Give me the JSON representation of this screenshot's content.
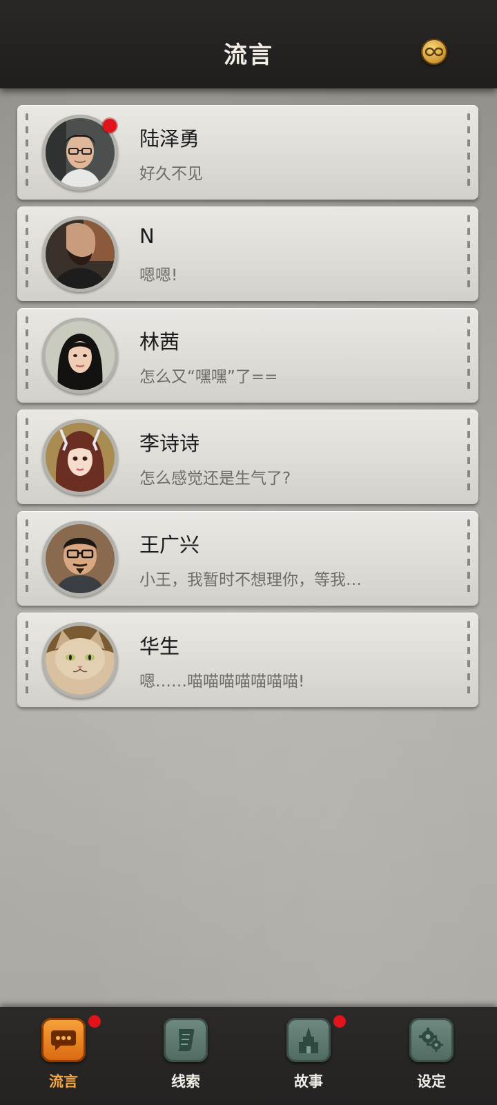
{
  "header": {
    "title": "流言",
    "right_icon": "infinity-coin-icon"
  },
  "messages": [
    {
      "name": "陆泽勇",
      "preview": "好久不见",
      "unread": true,
      "avatar": "man-with-glasses-avatar"
    },
    {
      "name": "N",
      "preview": "嗯嗯!",
      "unread": false,
      "avatar": "bearded-man-avatar"
    },
    {
      "name": "林茜",
      "preview": "怎么又“嘿嘿”了==",
      "unread": false,
      "avatar": "woman-long-hair-avatar"
    },
    {
      "name": "李诗诗",
      "preview": "怎么感觉还是生气了?",
      "unread": false,
      "avatar": "girl-hair-accessory-avatar"
    },
    {
      "name": "王广兴",
      "preview": "小王，我暂时不想理你，等我…",
      "unread": false,
      "avatar": "man-glasses-goatee-avatar"
    },
    {
      "name": "华生",
      "preview": "嗯……喵喵喵喵喵喵喵!",
      "unread": false,
      "avatar": "cat-avatar"
    }
  ],
  "nav": {
    "items": [
      {
        "label": "流言",
        "icon": "chat-bubble-icon",
        "active": true,
        "badge": true
      },
      {
        "label": "线索",
        "icon": "scroll-icon",
        "active": false,
        "badge": false
      },
      {
        "label": "故事",
        "icon": "tower-icon",
        "active": false,
        "badge": true
      },
      {
        "label": "设定",
        "icon": "gear-icon",
        "active": false,
        "badge": false
      }
    ]
  },
  "colors": {
    "header_bg": "#1f1e1d",
    "card_bg": "#e4e3df",
    "unread_dot": "#e0141a",
    "active_tab": "#f6a843",
    "inactive_tab": "#5d786e"
  }
}
